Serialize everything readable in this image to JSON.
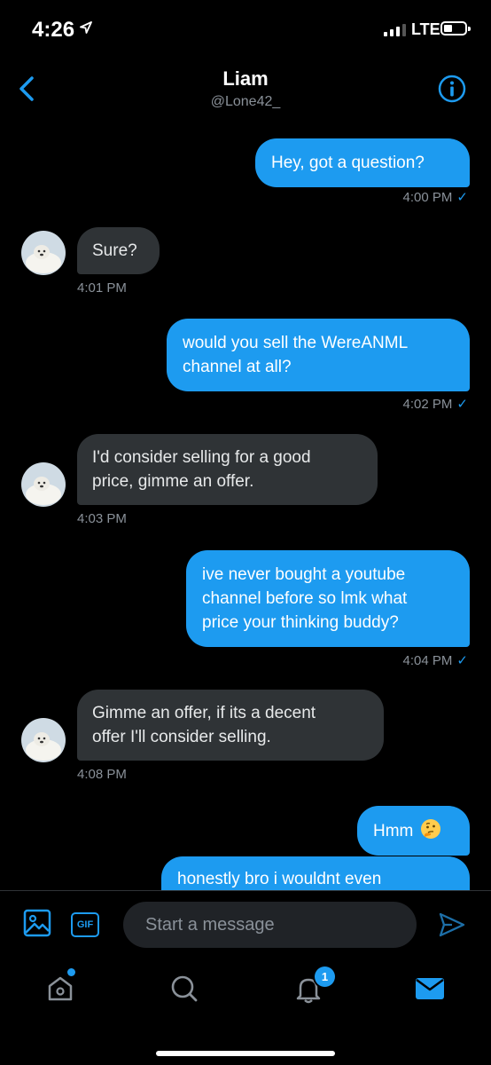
{
  "status": {
    "time": "4:26",
    "network": "LTE"
  },
  "header": {
    "name": "Liam",
    "handle": "@Lone42_"
  },
  "messages": [
    {
      "dir": "out",
      "lines": [
        "Hey, got a question?"
      ],
      "time": "4:00 PM"
    },
    {
      "dir": "in",
      "lines": [
        "Sure?"
      ],
      "time": "4:01 PM"
    },
    {
      "dir": "out",
      "lines": [
        "would you sell the WereANML",
        "channel at all?"
      ],
      "time": "4:02 PM"
    },
    {
      "dir": "in",
      "lines": [
        "I'd consider selling for a good",
        "price, gimme an offer."
      ],
      "time": "4:03 PM"
    },
    {
      "dir": "out",
      "lines": [
        "ive never bought a youtube",
        "channel before so lmk what",
        "price your thinking buddy?"
      ],
      "time": "4:04 PM"
    },
    {
      "dir": "in",
      "lines": [
        "Gimme an offer, if its a decent",
        "offer I'll consider selling."
      ],
      "time": "4:08 PM"
    },
    {
      "dir": "out",
      "lines": [
        "Hmm"
      ],
      "emoji": "thinking-face"
    },
    {
      "dir": "out",
      "lines": [
        "honestly bro i wouldnt even"
      ]
    }
  ],
  "read_mark": "✓",
  "composer": {
    "gif_label": "GIF",
    "placeholder": "Start a message"
  },
  "tabbar": {
    "notifications_badge": "1"
  },
  "colors": {
    "accent": "#1d9bf0",
    "incoming_bubble": "#2f3336",
    "muted": "#8a9199"
  },
  "icons": [
    "location-arrow-icon",
    "back-chevron-icon",
    "info-icon",
    "image-icon",
    "gif-icon",
    "send-icon",
    "home-icon",
    "search-icon",
    "bell-icon",
    "mail-icon"
  ]
}
